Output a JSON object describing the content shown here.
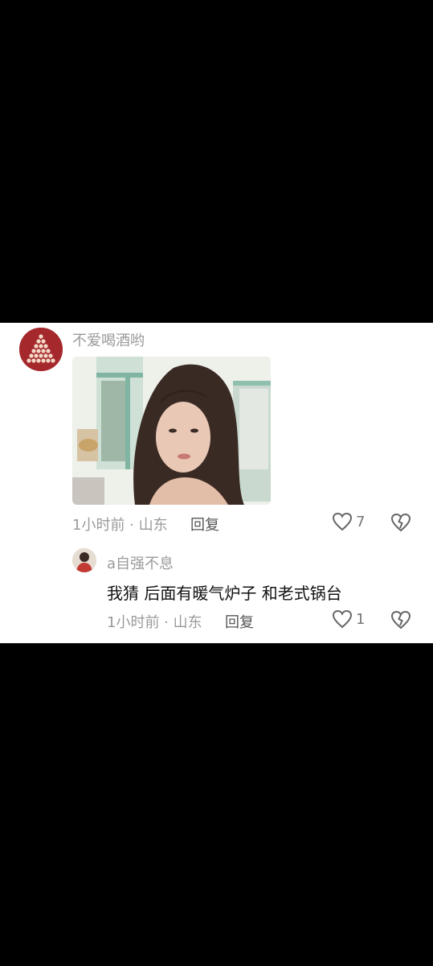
{
  "comment": {
    "username": "不爱喝酒哟",
    "meta": "1小时前 · 山东",
    "reply_label": "回复",
    "like_count": "7"
  },
  "reply": {
    "username": "a自强不息",
    "text": "我猜  后面有暖气炉子  和老式锅台",
    "meta": "1小时前 · 山东",
    "reply_label": "回复",
    "like_count": "1"
  },
  "colors": {
    "background": "#000000",
    "card": "#ffffff",
    "meta_text": "#9a9a9a",
    "main_avatar": "#a5292c"
  },
  "icons": {
    "like": "heart-outline-icon",
    "dislike": "broken-heart-icon"
  }
}
